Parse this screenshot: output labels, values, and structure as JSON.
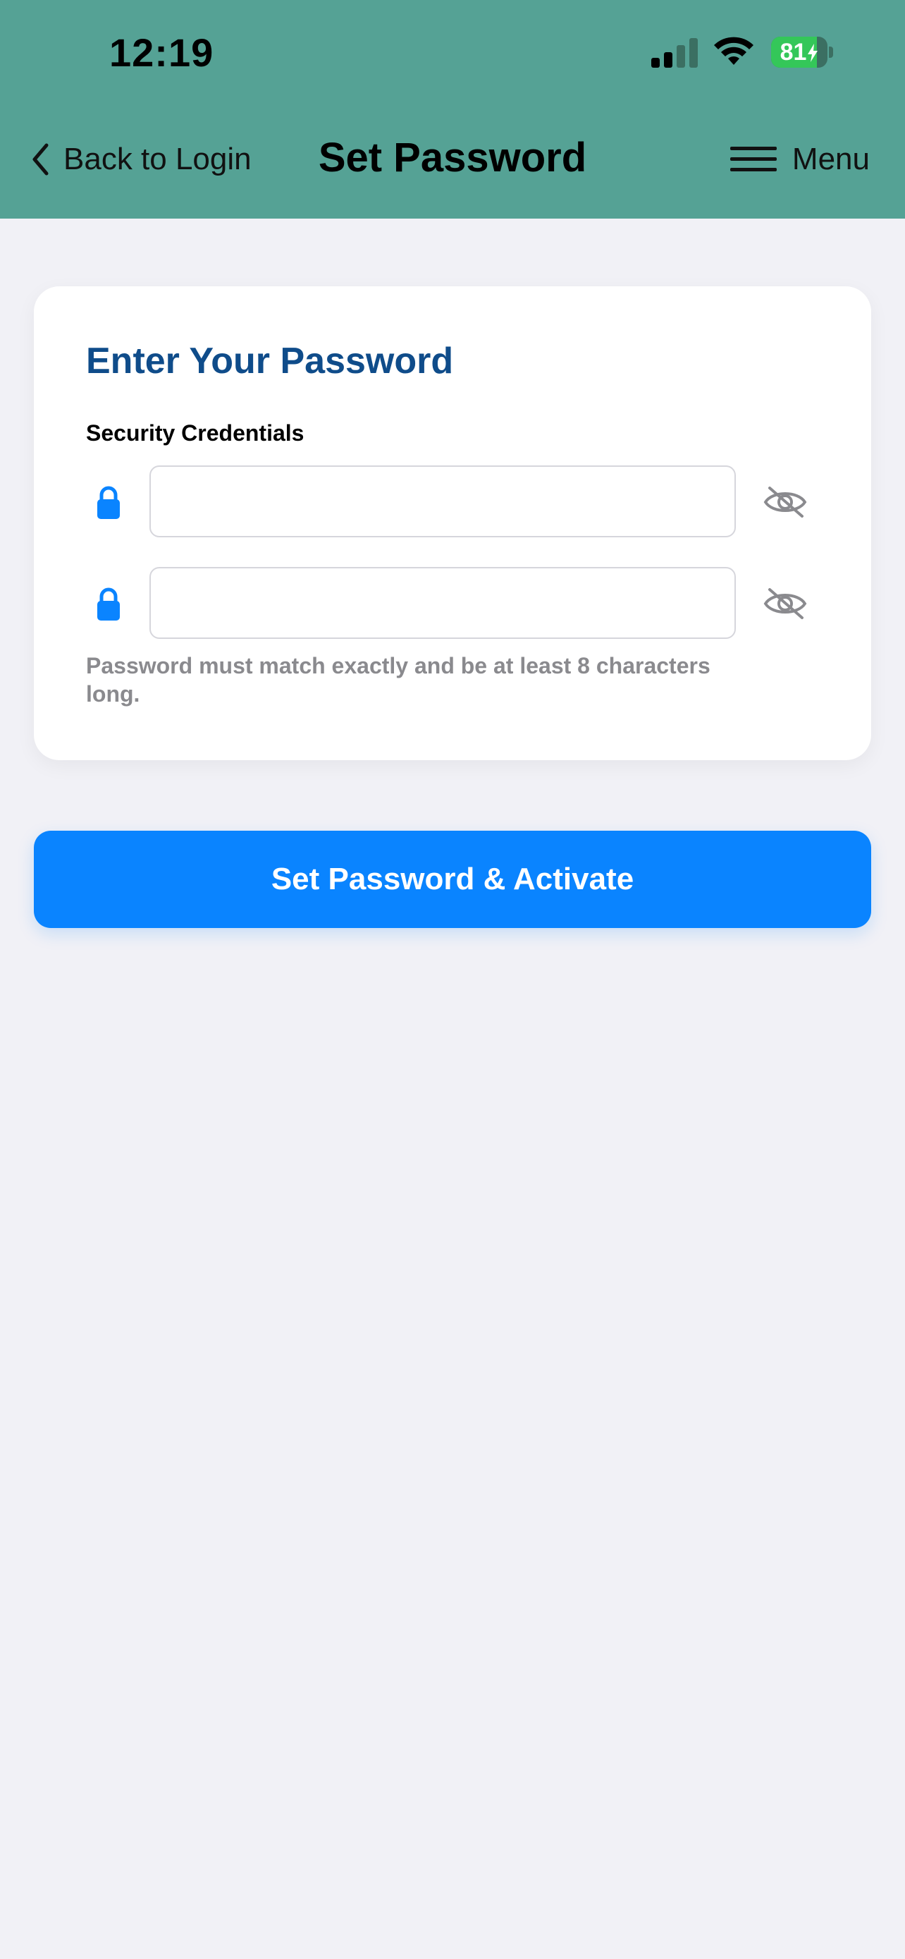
{
  "status_bar": {
    "time": "12:19",
    "battery_level": "81",
    "battery_fraction": 0.81,
    "signal_bars_active": 2,
    "signal_bars_total": 4,
    "icons": [
      "signal-icon",
      "wifi-icon",
      "battery-charging-icon"
    ]
  },
  "nav": {
    "back_label": "Back to Login",
    "title": "Set Password",
    "menu_label": "Menu",
    "icons": [
      "chevron-left-icon",
      "hamburger-icon"
    ]
  },
  "card": {
    "title": "Enter Your Password",
    "section_label": "Security Credentials",
    "password_field": {
      "value": "",
      "placeholder": ""
    },
    "confirm_field": {
      "value": "",
      "placeholder": ""
    },
    "helper_text": "Password must match exactly and be at least 8 characters long.",
    "icons": [
      "lock-icon",
      "eye-slash-icon"
    ]
  },
  "actions": {
    "submit_label": "Set Password & Activate"
  },
  "colors": {
    "header_bg": "#55a295",
    "background": "#f1f1f6",
    "accent": "#0a84ff",
    "title": "#0f4c8a",
    "battery_green": "#34c759",
    "helper_gray": "#8a8a8e"
  }
}
